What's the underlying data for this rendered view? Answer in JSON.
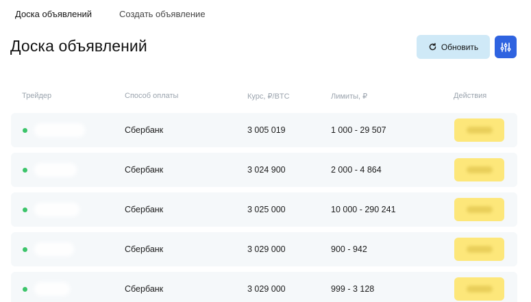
{
  "tabs": [
    "Доска объявлений",
    "Создать объявление"
  ],
  "page_title": "Доска объявлений",
  "toolbar": {
    "refresh_label": "Обновить",
    "refresh_icon": "refresh-icon",
    "filter_icon": "sliders-icon",
    "filter_color": "#2f63e0",
    "refresh_bg": "#cfe9f7"
  },
  "table": {
    "columns": [
      "Трейдер",
      "Способ оплаты",
      "Курс, ₽/BTC",
      "Лимиты, ₽",
      "Действия"
    ],
    "rows": [
      {
        "payment": "Сбербанк",
        "rate": "3 005 019",
        "limits": "1 000 - 29 507",
        "online": true
      },
      {
        "payment": "Сбербанк",
        "rate": "3 024 900",
        "limits": "2 000 - 4 864",
        "online": true
      },
      {
        "payment": "Сбербанк",
        "rate": "3 025 000",
        "limits": "10 000 - 290 241",
        "online": true
      },
      {
        "payment": "Сбербанк",
        "rate": "3 029 000",
        "limits": "900 - 942",
        "online": true
      },
      {
        "payment": "Сбербанк",
        "rate": "3 029 000",
        "limits": "999 - 3 128",
        "online": true
      }
    ],
    "status_color": "#3cc46a",
    "action_color": "#fde77a"
  }
}
